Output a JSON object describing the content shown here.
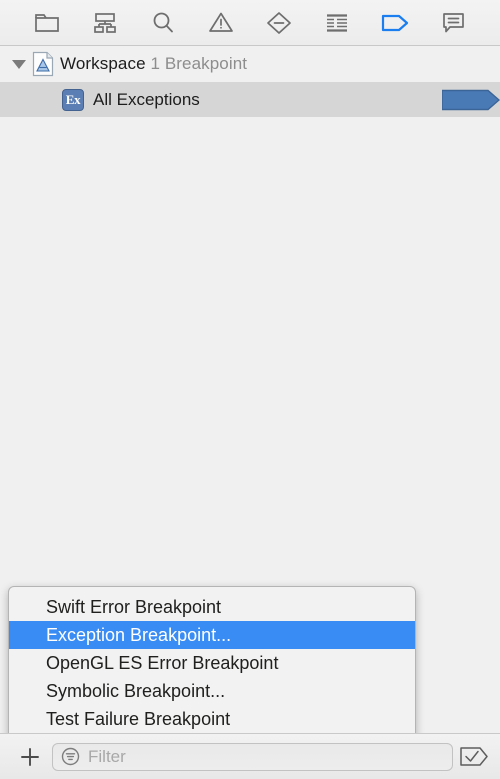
{
  "toolbar": {
    "buttons": [
      {
        "name": "project-navigator-icon",
        "label": "Project Navigator",
        "active": false
      },
      {
        "name": "hierarchy-navigator-icon",
        "label": "Symbol Navigator",
        "active": false
      },
      {
        "name": "search-icon",
        "label": "Find Navigator",
        "active": false
      },
      {
        "name": "warning-triangle-icon",
        "label": "Issue Navigator",
        "active": false
      },
      {
        "name": "test-diamond-icon",
        "label": "Test Navigator",
        "active": false
      },
      {
        "name": "debug-list-icon",
        "label": "Debug Navigator",
        "active": false
      },
      {
        "name": "breakpoint-arrow-icon",
        "label": "Breakpoint Navigator",
        "active": true
      },
      {
        "name": "report-speech-icon",
        "label": "Report Navigator",
        "active": false
      }
    ],
    "active_color": "#1a7df0",
    "inactive_color": "#6e6e6e"
  },
  "outline": {
    "workspace": {
      "title": "Workspace",
      "count_text": "1 Breakpoint",
      "expanded": true,
      "icon": "xcode-workspace-document-icon"
    },
    "breakpoint": {
      "label": "All Exceptions",
      "icon_text": "Ex",
      "icon": "exception-breakpoint-icon",
      "selected": true,
      "enabled": true,
      "marker_color": "#4a7ab5"
    }
  },
  "menu": {
    "items": [
      {
        "label": "Swift Error Breakpoint",
        "selected": false
      },
      {
        "label": "Exception Breakpoint...",
        "selected": true
      },
      {
        "label": "OpenGL ES Error Breakpoint",
        "selected": false
      },
      {
        "label": "Symbolic Breakpoint...",
        "selected": false
      },
      {
        "label": "Test Failure Breakpoint",
        "selected": false
      }
    ],
    "highlight_color": "#3a8cf5"
  },
  "bottombar": {
    "add_label": "+",
    "filter_placeholder": "Filter",
    "filter_value": "",
    "filter_icon": "filter-lines-circle-icon",
    "enable_icon": "breakpoint-check-icon"
  }
}
